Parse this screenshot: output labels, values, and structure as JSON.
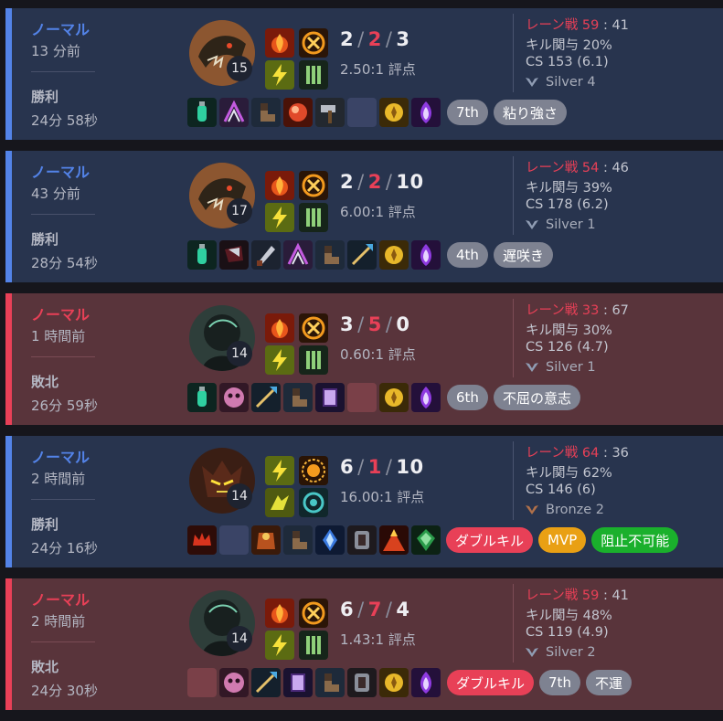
{
  "colors": {
    "win_bg": "#28344e",
    "loss_bg": "#59343b",
    "win_accent": "#5383e8",
    "loss_accent": "#e84057"
  },
  "matches": [
    {
      "result_type": "win",
      "mode": "ノーマル",
      "ago": "13 分前",
      "result": "勝利",
      "duration": "24分 58秒",
      "level": "15",
      "kills": "2",
      "deaths": "2",
      "assists": "3",
      "ratio": "2.50:1 評点",
      "lane": {
        "label": "レーン戦",
        "mine": "59",
        "theirs": "41"
      },
      "kill_participation": "キル関与 20%",
      "cs": "CS 153 (6.1)",
      "rank": "Silver 4",
      "champion_icon": "dragon-champion-portrait",
      "spells": [
        "ignite-icon",
        "smite-icon",
        "flash-icon",
        "rune-tree-icon"
      ],
      "items": [
        "potion-item",
        "claw-item",
        "boots-item",
        "orb-item",
        "hammer-item",
        "empty",
        "ward-item",
        "spirit-item"
      ],
      "tags": [
        {
          "label": "7th",
          "style": "gray"
        },
        {
          "label": "粘り強さ",
          "style": "gray"
        }
      ]
    },
    {
      "result_type": "win",
      "mode": "ノーマル",
      "ago": "43 分前",
      "result": "勝利",
      "duration": "28分 54秒",
      "level": "17",
      "kills": "2",
      "deaths": "2",
      "assists": "10",
      "ratio": "6.00:1 評点",
      "lane": {
        "label": "レーン戦",
        "mine": "54",
        "theirs": "46"
      },
      "kill_participation": "キル関与 39%",
      "cs": "CS 178 (6.2)",
      "rank": "Silver 1",
      "champion_icon": "dragon-champion-portrait",
      "spells": [
        "ignite-icon",
        "smite-icon",
        "flash-icon",
        "rune-tree-icon"
      ],
      "items": [
        "potion-item",
        "cleaver-item",
        "dagger-item",
        "claw-item",
        "boots-item",
        "spear-item",
        "ward-item",
        "spirit-item"
      ],
      "tags": [
        {
          "label": "4th",
          "style": "gray"
        },
        {
          "label": "遅咲き",
          "style": "gray"
        }
      ]
    },
    {
      "result_type": "loss",
      "mode": "ノーマル",
      "ago": "1 時間前",
      "result": "敗北",
      "duration": "26分 59秒",
      "level": "14",
      "kills": "3",
      "deaths": "5",
      "assists": "0",
      "ratio": "0.60:1 評点",
      "lane": {
        "label": "レーン戦",
        "mine": "33",
        "theirs": "67"
      },
      "kill_participation": "キル関与 30%",
      "cs": "CS 126 (4.7)",
      "rank": "Silver 1",
      "champion_icon": "shadow-champion-portrait",
      "spells": [
        "ignite-icon",
        "smite-icon",
        "flash-icon",
        "rune-tree-icon"
      ],
      "items": [
        "potion-item",
        "mask-item",
        "spear-item",
        "boots-item",
        "tome-item",
        "empty",
        "ward-item",
        "spirit-item"
      ],
      "tags": [
        {
          "label": "6th",
          "style": "gray"
        },
        {
          "label": "不屈の意志",
          "style": "gray"
        }
      ]
    },
    {
      "result_type": "win",
      "mode": "ノーマル",
      "ago": "2 時間前",
      "result": "勝利",
      "duration": "24分 16秒",
      "level": "14",
      "kills": "6",
      "deaths": "1",
      "assists": "10",
      "ratio": "16.00:1 評点",
      "lane": {
        "label": "レーン戦",
        "mine": "64",
        "theirs": "36"
      },
      "kill_participation": "キル関与 62%",
      "cs": "CS 146 (6)",
      "rank": "Bronze 2",
      "champion_icon": "demon-champion-portrait",
      "spells": [
        "flash-icon",
        "sun-rune-icon",
        "sprint-icon",
        "swirl-rune-icon"
      ],
      "items": [
        "crown-item",
        "empty",
        "cloak-item",
        "boots-item",
        "crystal-item",
        "armor-item",
        "volcano-item",
        "emerald-item"
      ],
      "tags": [
        {
          "label": "ダブルキル",
          "style": "red"
        },
        {
          "label": "MVP",
          "style": "gold"
        },
        {
          "label": "阻止不可能",
          "style": "green"
        }
      ]
    },
    {
      "result_type": "loss",
      "mode": "ノーマル",
      "ago": "2 時間前",
      "result": "敗北",
      "duration": "24分 30秒",
      "level": "14",
      "kills": "6",
      "deaths": "7",
      "assists": "4",
      "ratio": "1.43:1 評点",
      "lane": {
        "label": "レーン戦",
        "mine": "59",
        "theirs": "41"
      },
      "kill_participation": "キル関与 48%",
      "cs": "CS 119 (4.9)",
      "rank": "Silver 2",
      "champion_icon": "shadow-champion-portrait",
      "spells": [
        "ignite-icon",
        "smite-icon",
        "flash-icon",
        "rune-tree-icon"
      ],
      "items": [
        "empty",
        "mask-item",
        "spear-item",
        "tome-item",
        "boots-item",
        "armor-item",
        "ward-item",
        "spirit-item"
      ],
      "tags": [
        {
          "label": "ダブルキル",
          "style": "red"
        },
        {
          "label": "7th",
          "style": "gray"
        },
        {
          "label": "不運",
          "style": "gray"
        }
      ]
    }
  ]
}
